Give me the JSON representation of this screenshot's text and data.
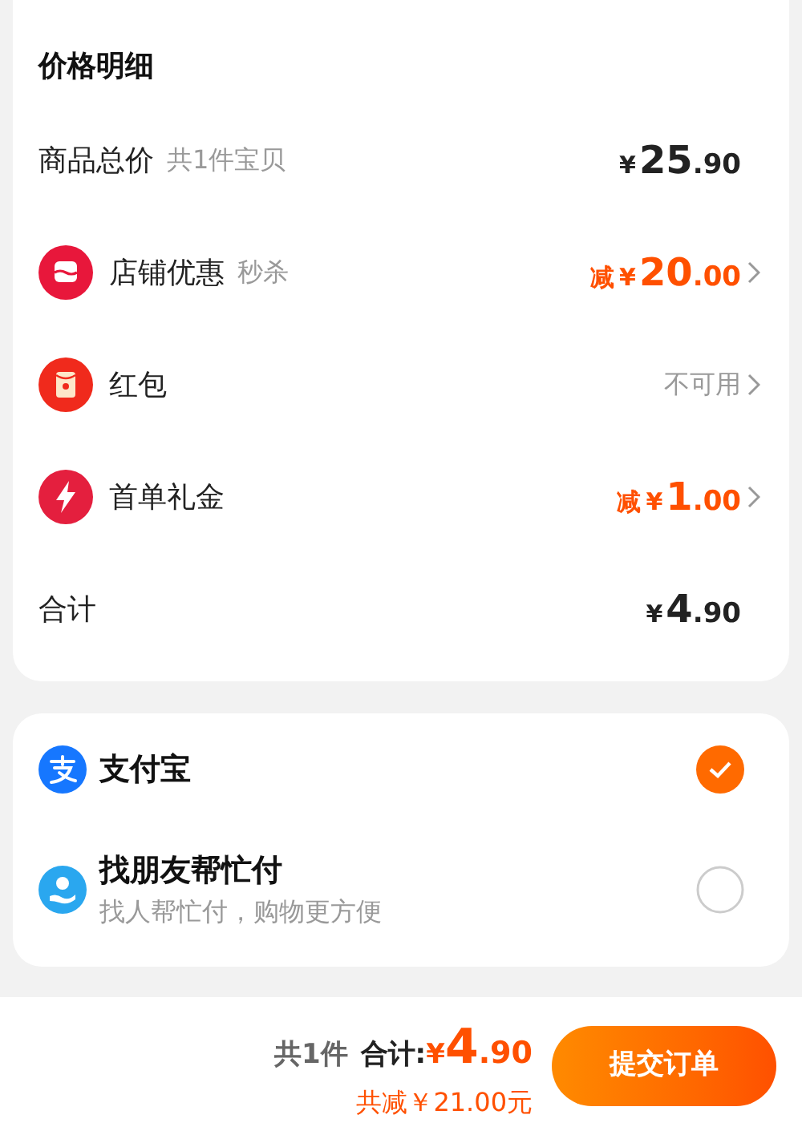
{
  "price_detail": {
    "title": "价格明细",
    "rows": [
      {
        "label": "商品总价",
        "note": "共1件宝贝",
        "kind": "price",
        "value": {
          "currency": "¥",
          "integer": "25",
          "decimal": ".90"
        },
        "chevron": false
      },
      {
        "label": "店铺优惠",
        "note": "秒杀",
        "kind": "discount",
        "value": {
          "prefix": "减",
          "currency": "¥",
          "integer": "20",
          "decimal": ".00"
        },
        "chevron": true
      },
      {
        "label": "红包",
        "kind": "status",
        "value": {
          "text": "不可用"
        },
        "chevron": true
      },
      {
        "label": "首单礼金",
        "kind": "discount",
        "value": {
          "prefix": "减",
          "currency": "¥",
          "integer": "1",
          "decimal": ".00"
        },
        "chevron": true
      },
      {
        "label": "合计",
        "kind": "price",
        "value": {
          "currency": "¥",
          "integer": "4",
          "decimal": ".90"
        },
        "chevron": false
      }
    ]
  },
  "payment_methods": [
    {
      "name": "支付宝",
      "selected": true
    },
    {
      "name": "找朋友帮忙付",
      "description": "找人帮忙付，购物更方便",
      "selected": false
    }
  ],
  "bottom_bar": {
    "count": "共1件",
    "total_label": "合计:",
    "total": {
      "currency": "¥",
      "integer": "4",
      "decimal": ".90"
    },
    "saving": "共减￥21.00元",
    "submit": "提交订单"
  }
}
